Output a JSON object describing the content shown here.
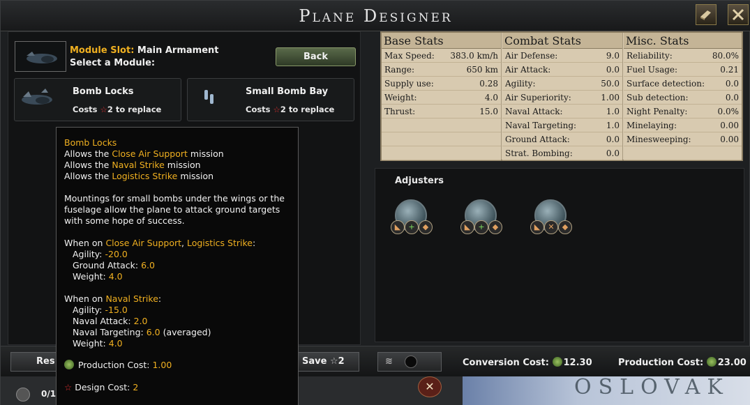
{
  "window": {
    "title": "Plane Designer"
  },
  "module_slot": {
    "label": "Module Slot:",
    "value": "Main Armament",
    "prompt": "Select a Module:",
    "back_label": "Back"
  },
  "modules": [
    {
      "name": "Bomb Locks",
      "cost_prefix": "Costs",
      "cost_value": "2",
      "cost_suffix": "to replace"
    },
    {
      "name": "Small Bomb Bay",
      "cost_prefix": "Costs",
      "cost_value": "2",
      "cost_suffix": "to replace"
    }
  ],
  "tooltip": {
    "title": "Bomb Locks",
    "allows": [
      {
        "prefix": "Allows the",
        "mission": "Close Air Support",
        "suffix": "mission"
      },
      {
        "prefix": "Allows the",
        "mission": "Naval Strike",
        "suffix": "mission"
      },
      {
        "prefix": "Allows the",
        "mission": "Logistics Strike",
        "suffix": "mission"
      }
    ],
    "description_lines": [
      "Mountings for small bombs under the wings or the",
      "fuselage allow the plane to attack ground targets",
      "with some hope of success."
    ],
    "group1": {
      "when": "When on",
      "mission_a": "Close Air Support",
      "sep": ",",
      "mission_b": "Logistics Strike",
      "colon": ":",
      "lines": [
        {
          "label": "Agility:",
          "value": "-20.0",
          "extra": ""
        },
        {
          "label": "Ground Attack:",
          "value": "6.0",
          "extra": ""
        },
        {
          "label": "Weight:",
          "value": "4.0",
          "extra": ""
        }
      ]
    },
    "group2": {
      "when": "When on",
      "mission": "Naval Strike",
      "colon": ":",
      "lines": [
        {
          "label": "Agility:",
          "value": "-15.0",
          "extra": ""
        },
        {
          "label": "Naval Attack:",
          "value": "2.0",
          "extra": ""
        },
        {
          "label": "Naval Targeting:",
          "value": "6.0",
          "extra": "(averaged)"
        },
        {
          "label": "Weight:",
          "value": "4.0",
          "extra": ""
        }
      ]
    },
    "production_cost_label": "Production Cost:",
    "production_cost_value": "1.00",
    "design_cost_label": "Design Cost:",
    "design_cost_value": "2"
  },
  "stats": {
    "base": {
      "header": "Base Stats",
      "rows": [
        {
          "label": "Max Speed:",
          "value": "383.0 km/h"
        },
        {
          "label": "Range:",
          "value": "650 km"
        },
        {
          "label": "Supply use:",
          "value": "0.28"
        },
        {
          "label": "Weight:",
          "value": "4.0"
        },
        {
          "label": "Thrust:",
          "value": "15.0"
        },
        {
          "label": "",
          "value": ""
        },
        {
          "label": "",
          "value": ""
        },
        {
          "label": "",
          "value": ""
        }
      ]
    },
    "combat": {
      "header": "Combat Stats",
      "rows": [
        {
          "label": "Air Defense:",
          "value": "9.0"
        },
        {
          "label": "Air Attack:",
          "value": "0.0"
        },
        {
          "label": "Agility:",
          "value": "50.0"
        },
        {
          "label": "Air Superiority:",
          "value": "1.00"
        },
        {
          "label": "Naval Attack:",
          "value": "1.0"
        },
        {
          "label": "Naval Targeting:",
          "value": "1.0"
        },
        {
          "label": "Ground Attack:",
          "value": "0.0"
        },
        {
          "label": "Strat. Bombing:",
          "value": "0.0"
        }
      ]
    },
    "misc": {
      "header": "Misc. Stats",
      "rows": [
        {
          "label": "Reliability:",
          "value": "80.0%"
        },
        {
          "label": "Fuel Usage:",
          "value": "0.21"
        },
        {
          "label": "Surface detection:",
          "value": "0.0"
        },
        {
          "label": "Sub detection:",
          "value": "0.0"
        },
        {
          "label": "Night Penalty:",
          "value": "0.0%"
        },
        {
          "label": "Minelaying:",
          "value": "0.00"
        },
        {
          "label": "Minesweeping:",
          "value": "0.00"
        },
        {
          "label": "",
          "value": ""
        }
      ]
    }
  },
  "adjusters": {
    "title": "Adjusters"
  },
  "bottom": {
    "reset_label": "Res",
    "save_label": "Save",
    "save_cost": "2",
    "conversion_cost_label": "Conversion Cost:",
    "conversion_cost_value": "12.30",
    "production_cost_label": "Production Cost:",
    "production_cost_value": "23.00",
    "page_counter": "0/1",
    "map_label": "OSLOVAK"
  },
  "colors": {
    "accent_yellow": "#f0b020",
    "star_red": "#e03030",
    "stats_bg": "#d8cab0"
  },
  "icons": [
    "book-icon",
    "close-icon",
    "bomb-locks-icon",
    "small-bomb-bay-icon",
    "star-icon",
    "production-cog-icon"
  ]
}
